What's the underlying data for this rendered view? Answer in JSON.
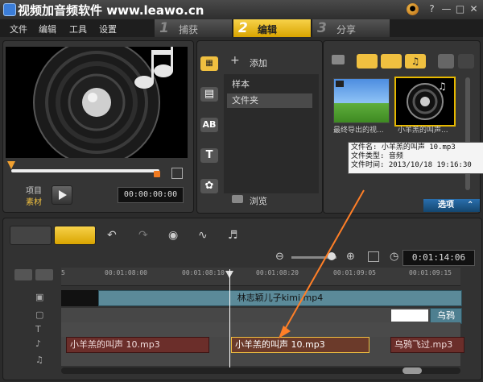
{
  "app": {
    "title": "视频加音频软件 www.leawo.cn"
  },
  "menu": [
    "文件",
    "编辑",
    "工具",
    "设置"
  ],
  "steps": [
    {
      "num": "1",
      "label": "捕获"
    },
    {
      "num": "2",
      "label": "编辑"
    },
    {
      "num": "3",
      "label": "分享"
    }
  ],
  "player": {
    "item_label": "项目",
    "clip_label": "素材",
    "timecode": "00:00:00:00"
  },
  "library": {
    "add_label": "添加",
    "folders": [
      "样本",
      "文件夹"
    ],
    "browse_label": "浏览",
    "thumbs": [
      {
        "caption": "最终导出的视..."
      },
      {
        "caption": "小羊羔的叫声..."
      }
    ],
    "tooltip": [
      "文件名: 小羊羔的叫声 10.mp3",
      "文件类型: 音频",
      "文件时间: 2013/10/18 19:16:30"
    ],
    "options_label": "选项"
  },
  "timeline": {
    "timecode": "0:01:14:06",
    "ruler": [
      "5",
      "00:01:08:00",
      "00:01:08:10",
      "00:01:08:20",
      "00:01:09:05",
      "00:01:09:15"
    ],
    "video_clip": "林志颖儿子kimi.mp4",
    "overlay_clip": "乌鸦",
    "audio_clips": [
      "小羊羔的叫声 10.mp3",
      "小羊羔的叫声 10.mp3",
      "乌鸦飞过.mp3"
    ]
  },
  "colors": {
    "accent": "#f0c040",
    "arrow": "#ff7f27"
  }
}
